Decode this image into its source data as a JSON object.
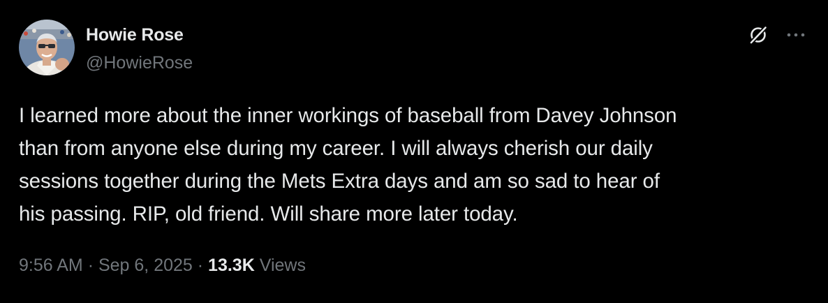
{
  "author": {
    "name": "Howie Rose",
    "handle": "@HowieRose"
  },
  "actions": {
    "grok_icon": "grok-icon",
    "more_icon": "more-icon"
  },
  "tweet": {
    "lines": [
      "I learned more about the inner workings of baseball from Davey Johnson",
      "than from anyone else during my career. I will always cherish our daily",
      "sessions together during the Mets Extra days and am so sad to hear of",
      "his passing. RIP, old friend. Will share more later today."
    ]
  },
  "meta": {
    "time": "9:56 AM",
    "separator": "·",
    "date": "Sep 6, 2025",
    "views_count": "13.3K",
    "views_label": "Views"
  },
  "colors": {
    "background": "#000000",
    "primary_text": "#e7e9ea",
    "secondary_text": "#71767b"
  }
}
